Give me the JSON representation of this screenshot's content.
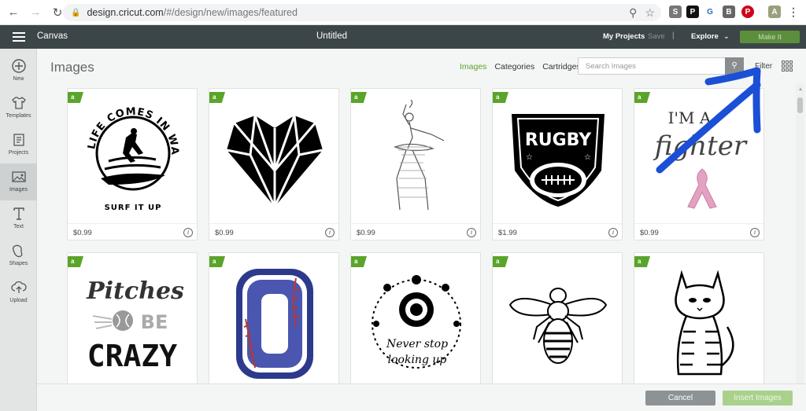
{
  "browser": {
    "url_host": "design.cricut.com",
    "url_path": "/#/design/new/images/featured",
    "extensions": [
      "S",
      "P",
      "G",
      "B",
      "P",
      "A"
    ]
  },
  "appbar": {
    "app_title": "Canvas",
    "doc_title": "Untitled",
    "my_projects": "My Projects",
    "save": "Save",
    "separator": "|",
    "explore": "Explore",
    "make_it": "Make It",
    "colors": {
      "bar": "#3c4649",
      "make_it": "#5c8f3b"
    }
  },
  "sidebar": {
    "items": [
      {
        "label": "New",
        "icon": "plus-circle-icon"
      },
      {
        "label": "Templates",
        "icon": "shirt-icon"
      },
      {
        "label": "Projects",
        "icon": "projects-icon"
      },
      {
        "label": "Images",
        "icon": "image-icon",
        "active": true
      },
      {
        "label": "Text",
        "icon": "text-icon"
      },
      {
        "label": "Shapes",
        "icon": "shapes-icon"
      },
      {
        "label": "Upload",
        "icon": "upload-icon"
      }
    ]
  },
  "main": {
    "title": "Images",
    "tabs": [
      {
        "label": "Images",
        "active": true
      },
      {
        "label": "Categories"
      },
      {
        "label": "Cartridges"
      }
    ],
    "search_placeholder": "Search Images",
    "filter": "Filter",
    "accent": "#5ba42b"
  },
  "cards": [
    {
      "art": "life-comes-in-waves-surf",
      "price": "$0.99",
      "texts": [
        "LIFE COMES IN WAVES",
        "SURF IT UP"
      ]
    },
    {
      "art": "geometric-heart",
      "price": "$0.99"
    },
    {
      "art": "ballerina",
      "price": "$0.99"
    },
    {
      "art": "rugby-shield",
      "price": "$1.99",
      "texts": [
        "RUGBY"
      ]
    },
    {
      "art": "im-a-fighter-ribbon",
      "price": "$0.99",
      "texts": [
        "I'M A",
        "fighter"
      ]
    },
    {
      "art": "pitches-be-crazy",
      "price": "",
      "texts": [
        "Pitches",
        "BE",
        "CRAZY"
      ]
    },
    {
      "art": "baseball-letter-o",
      "price": ""
    },
    {
      "art": "never-stop-looking-up",
      "price": "",
      "texts": [
        "Never stop",
        "looking up"
      ]
    },
    {
      "art": "bee",
      "price": ""
    },
    {
      "art": "cat",
      "price": ""
    }
  ],
  "footer": {
    "cancel": "Cancel",
    "insert": "Insert Images"
  }
}
